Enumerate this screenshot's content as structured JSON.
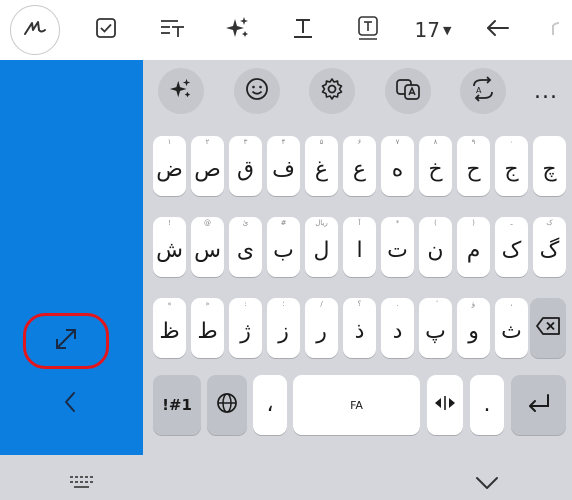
{
  "toolbar": {
    "items": [
      {
        "icon": "handwriting-icon"
      },
      {
        "icon": "checkbox-icon"
      },
      {
        "icon": "text-format-icon"
      },
      {
        "icon": "sparkle-ai-icon"
      },
      {
        "icon": "text-underline-icon"
      },
      {
        "icon": "text-box-icon"
      }
    ],
    "font_size": "17",
    "undo_icon": "undo-icon",
    "redo_icon": "redo-icon"
  },
  "side_panel": {
    "color": "#0b7ee0",
    "expand_icon": "expand-arrows-icon",
    "collapse_icon": "chevron-left-icon",
    "highlight_color": "#e3161e"
  },
  "keyboard": {
    "top_row_icons": [
      "sparkle-icon",
      "emoji-icon",
      "settings-icon",
      "translate-icon",
      "swap-icon",
      "more-icon"
    ],
    "more_label": "...",
    "rows": [
      {
        "keys": [
          {
            "main": "ض",
            "hint": "۱"
          },
          {
            "main": "ص",
            "hint": "۲"
          },
          {
            "main": "ق",
            "hint": "۳"
          },
          {
            "main": "ف",
            "hint": "۴"
          },
          {
            "main": "غ",
            "hint": "۵"
          },
          {
            "main": "ع",
            "hint": "۶"
          },
          {
            "main": "ه",
            "hint": "۷"
          },
          {
            "main": "خ",
            "hint": "۸"
          },
          {
            "main": "ح",
            "hint": "۹"
          },
          {
            "main": "ج",
            "hint": "۰"
          },
          {
            "main": "چ",
            "hint": "‍"
          }
        ]
      },
      {
        "keys": [
          {
            "main": "ش",
            "hint": "!"
          },
          {
            "main": "س",
            "hint": "@"
          },
          {
            "main": "ی",
            "hint": "ئ"
          },
          {
            "main": "ب",
            "hint": "#"
          },
          {
            "main": "ل",
            "hint": "ریال"
          },
          {
            "main": "ا",
            "hint": "آ"
          },
          {
            "main": "ت",
            "hint": "*"
          },
          {
            "main": "ن",
            "hint": "("
          },
          {
            "main": "م",
            "hint": ")"
          },
          {
            "main": "ک",
            "hint": "ـ"
          },
          {
            "main": "گ",
            "hint": "ک"
          }
        ]
      },
      {
        "keys": [
          {
            "main": "ظ",
            "hint": "«"
          },
          {
            "main": "ط",
            "hint": "»"
          },
          {
            "main": "ژ",
            "hint": ":"
          },
          {
            "main": "ز",
            "hint": "؛"
          },
          {
            "main": "ر",
            "hint": "/"
          },
          {
            "main": "ذ",
            "hint": "؟"
          },
          {
            "main": "د",
            "hint": "."
          },
          {
            "main": "پ",
            "hint": "ٔ"
          },
          {
            "main": "و",
            "hint": "ؤ"
          },
          {
            "main": "ث",
            "hint": "،"
          }
        ]
      }
    ],
    "bottom_row": {
      "symbols_label": "!#1",
      "comma_label": "،",
      "space_label": "FA",
      "period_label": "."
    }
  },
  "bottom_bar": {
    "keyboard_icon": "keyboard-icon",
    "hide_icon": "chevron-down-icon"
  }
}
